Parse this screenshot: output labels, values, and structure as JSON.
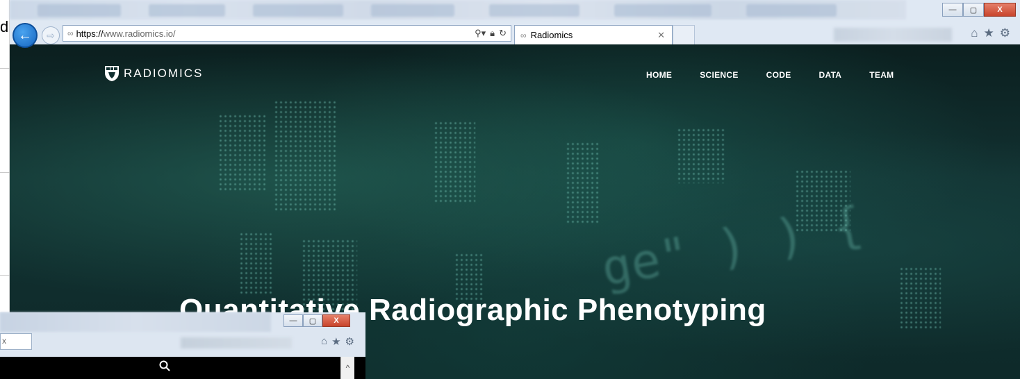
{
  "left_strip": {
    "stub_text": "d"
  },
  "browser": {
    "address": {
      "url_scheme": "https://",
      "url_rest": "www.radiomics.io/"
    },
    "tab": {
      "title": "Radiomics"
    },
    "window_controls": {
      "minimize": "—",
      "restore": "▢",
      "close": "X"
    }
  },
  "site": {
    "brand": "RADIOMICS",
    "nav": [
      "HOME",
      "SCIENCE",
      "CODE",
      "DATA",
      "TEAM"
    ],
    "hero_title": "Quantitative Radiographic Phenotyping",
    "background_glyphs": "ge\" ) ) {"
  },
  "mini_window": {
    "window_controls": {
      "minimize": "—",
      "restore": "▢",
      "close": "X"
    }
  },
  "icons": {
    "back": "back-arrow-icon",
    "forward": "forward-arrow-icon",
    "search": "search-icon",
    "lock": "lock-icon",
    "refresh": "refresh-icon",
    "home": "home-icon",
    "favorites": "star-icon",
    "settings": "gear-icon"
  },
  "colors": {
    "chrome": "#dfe8f3",
    "back_button": "#1565c0",
    "site_bg": "#0e2a2a",
    "close_button": "#c8442c"
  }
}
